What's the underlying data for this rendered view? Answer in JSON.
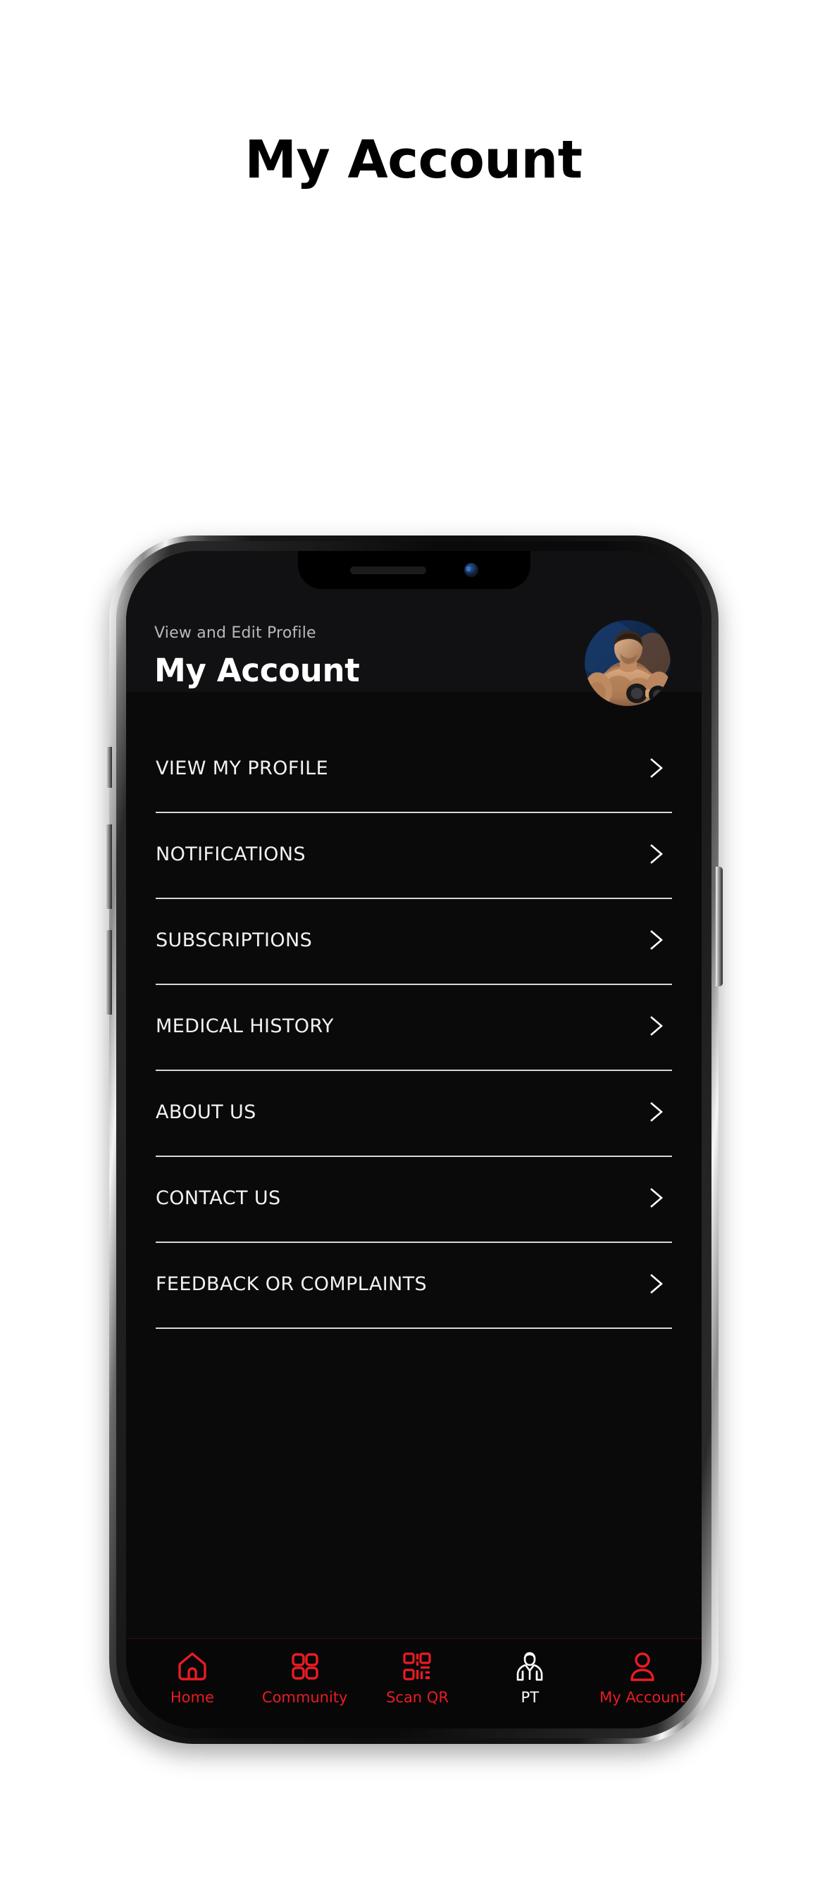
{
  "page": {
    "title": "My Account"
  },
  "device": {
    "notch": {
      "speaker": "speaker-grille",
      "camera": "front-camera"
    }
  },
  "app": {
    "header": {
      "subtitle": "View and Edit Profile",
      "title": "My Account",
      "avatar_alt": "bodybuilder-profile-photo"
    },
    "menu": {
      "items": [
        {
          "label": "VIEW MY PROFILE",
          "chevron": "chevron-right-icon"
        },
        {
          "label": "NOTIFICATIONS",
          "chevron": "chevron-right-icon"
        },
        {
          "label": "SUBSCRIPTIONS",
          "chevron": "chevron-right-icon"
        },
        {
          "label": "MEDICAL HISTORY",
          "chevron": "chevron-right-icon"
        },
        {
          "label": "ABOUT US",
          "chevron": "chevron-right-icon"
        },
        {
          "label": "CONTACT US",
          "chevron": "chevron-right-icon"
        },
        {
          "label": "FEEDBACK OR COMPLAINTS",
          "chevron": "chevron-right-icon"
        }
      ]
    },
    "tabbar": {
      "items": [
        {
          "label": "Home",
          "icon": "home-icon",
          "color": "#ea1b23",
          "active": false
        },
        {
          "label": "Community",
          "icon": "grid-icon",
          "color": "#ea1b23",
          "active": false
        },
        {
          "label": "Scan QR",
          "icon": "qr-code-icon",
          "color": "#ea1b23",
          "active": false
        },
        {
          "label": "PT",
          "icon": "trainer-icon",
          "color": "#ffffff",
          "active": true
        },
        {
          "label": "My Account",
          "icon": "user-icon",
          "color": "#ea1b23",
          "active": false
        }
      ]
    }
  },
  "colors": {
    "accent_red": "#ea1b23",
    "screen_bg": "#0a0a0b",
    "header_bg": "#111113",
    "divider": "#d8d8d8",
    "text_primary": "#f2f2f2",
    "text_secondary": "#b9b9bd"
  }
}
